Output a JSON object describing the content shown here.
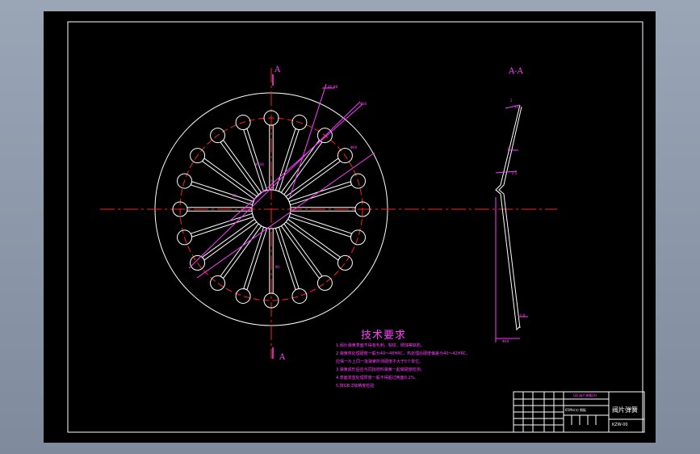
{
  "drawing": {
    "section_mark_top": "A",
    "section_mark_bottom": "A",
    "section_view_title": "A-A",
    "requirements_title": "技术要求",
    "requirements": [
      "1.阀片弹簧表面不得有毛刺、裂纹、锈蚀等缺陷。",
      "2.弹簧热处理硬度一般为40～46HRC，热处理后硬度偏差为40～42HRC。",
      "  应保一片上同一批弹簧所测硬度不大于5个单位。",
      "3.弹簧成形后应与同批材料弹簧一起做硬度检测。",
      "4.表面发蓝处理厚度一般不得超过两面0.2%。",
      "5.按GB-Z级精度检验"
    ],
    "title_block": {
      "part_name": "阀片弹簧",
      "drawing_code": "KZW-00",
      "reference_text": "GB 阀片弹簧ZH",
      "material_text": "65Mn(n) 钢板"
    },
    "dimension_labels": [
      "4X Φ8",
      "Φ80",
      "Φ60",
      "Φ108",
      "R5",
      "Φ5",
      "2",
      "1",
      "0.5",
      "0.8",
      "Φ40",
      "35"
    ]
  },
  "colors": {
    "sheet": "#000000",
    "outline": "#ffffff",
    "centerline": "#ff2020",
    "annotation": "#ff3dff"
  }
}
